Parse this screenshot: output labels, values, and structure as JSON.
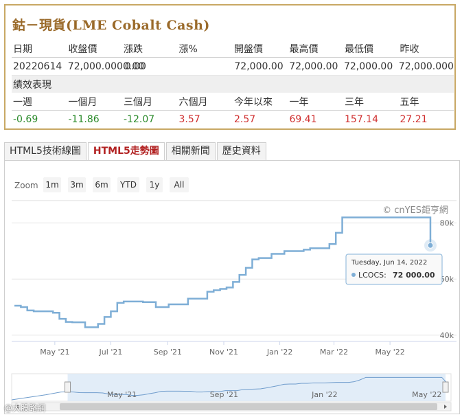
{
  "quote": {
    "title": "鈷－現貨(LME Cobalt Cash)",
    "headers": [
      "日期",
      "收盤價",
      "漲跌",
      "漲%",
      "開盤價",
      "最高價",
      "最低價",
      "昨收"
    ],
    "values": [
      "20220614",
      "72,000.0000.00",
      "0.00",
      "",
      "72,000.00",
      "72,000.00",
      "72,000.00",
      "72,000.000"
    ],
    "section_label": "績效表現",
    "perf_headers": [
      "一週",
      "一個月",
      "三個月",
      "六個月",
      "今年以來",
      "一年",
      "三年",
      "五年"
    ],
    "perf_values": [
      "-0.69",
      "-11.86",
      "-12.07",
      "3.57",
      "2.57",
      "69.41",
      "157.14",
      "27.21"
    ],
    "perf_colors": [
      "#2a8a2a",
      "#2a8a2a",
      "#2a8a2a",
      "#d03030",
      "#d03030",
      "#d03030",
      "#d03030",
      "#d03030"
    ]
  },
  "tabs": [
    {
      "label": "HTML5技術線圖",
      "active": false
    },
    {
      "label": "HTML5走勢圖",
      "active": true
    },
    {
      "label": "相關新聞",
      "active": false
    },
    {
      "label": "歷史資料",
      "active": false
    }
  ],
  "zoom": {
    "label": "Zoom",
    "buttons": [
      "1m",
      "3m",
      "6m",
      "YTD",
      "1y",
      "All"
    ]
  },
  "credits": "© cnYES鉅亨網",
  "tooltip": {
    "date": "Tuesday, Jun 14, 2022",
    "series": "LCOCS:",
    "value": "72 000.00"
  },
  "watermark": "@大股路網",
  "chart_data": {
    "type": "line",
    "series": [
      {
        "name": "LCOCS",
        "color": "#7eaed6",
        "x": [
          "2021-03-18",
          "2021-03-25",
          "2021-04-01",
          "2021-04-08",
          "2021-04-15",
          "2021-04-22",
          "2021-04-29",
          "2021-05-06",
          "2021-05-13",
          "2021-05-20",
          "2021-05-27",
          "2021-06-03",
          "2021-06-10",
          "2021-06-17",
          "2021-06-24",
          "2021-07-01",
          "2021-07-08",
          "2021-07-15",
          "2021-07-22",
          "2021-07-29",
          "2021-08-05",
          "2021-08-12",
          "2021-08-19",
          "2021-08-26",
          "2021-09-02",
          "2021-09-09",
          "2021-09-16",
          "2021-09-23",
          "2021-09-30",
          "2021-10-07",
          "2021-10-14",
          "2021-10-21",
          "2021-10-28",
          "2021-11-04",
          "2021-11-11",
          "2021-11-18",
          "2021-11-25",
          "2021-12-02",
          "2021-12-09",
          "2021-12-16",
          "2021-12-23",
          "2021-12-30",
          "2022-01-06",
          "2022-01-13",
          "2022-01-20",
          "2022-01-27",
          "2022-02-03",
          "2022-02-10",
          "2022-02-17",
          "2022-02-24",
          "2022-03-03",
          "2022-03-10",
          "2022-03-17",
          "2022-03-24",
          "2022-03-31",
          "2022-04-07",
          "2022-04-14",
          "2022-04-21",
          "2022-04-28",
          "2022-05-05",
          "2022-05-12",
          "2022-05-19",
          "2022-05-26",
          "2022-06-02",
          "2022-06-09",
          "2022-06-14"
        ],
        "values": [
          50500,
          50000,
          48800,
          48500,
          48500,
          48500,
          48000,
          45800,
          44700,
          44600,
          44600,
          42800,
          42800,
          44000,
          46500,
          48500,
          51500,
          52000,
          52000,
          52000,
          51800,
          51800,
          50000,
          50000,
          51000,
          51000,
          51000,
          53000,
          53000,
          53000,
          55500,
          56000,
          56500,
          57000,
          59000,
          61500,
          64000,
          67000,
          67500,
          67500,
          69000,
          69000,
          70000,
          70000,
          70000,
          70500,
          71000,
          71000,
          71000,
          72500,
          76500,
          82000,
          82000,
          82000,
          82000,
          82000,
          82000,
          82000,
          82000,
          82000,
          82000,
          82000,
          82000,
          82000,
          82000,
          72000
        ]
      }
    ],
    "xticks": [
      "May '21",
      "Jul '21",
      "Sep '21",
      "Nov '21",
      "Jan '22",
      "Mar '22",
      "May '22"
    ],
    "yticks": [
      "40k",
      "60k",
      "80k"
    ],
    "ylim": [
      38000,
      88000
    ],
    "xlim": [
      "2021-03-18",
      "2022-06-20"
    ],
    "navigator_ticks": [
      "May '21",
      "Sep '21",
      "Jan '22",
      "May '22"
    ],
    "grid": true
  }
}
